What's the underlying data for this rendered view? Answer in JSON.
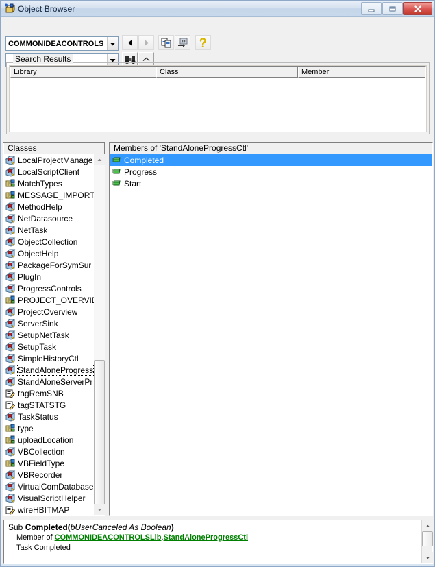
{
  "window": {
    "title": "Object Browser",
    "icon": "object-browser-icon",
    "buttons": {
      "minimize": "minimize-button",
      "restore": "restore-button",
      "close": "close-button"
    }
  },
  "toolbar": {
    "library_combo": {
      "value": "COMMONIDEACONTROLS",
      "placeholder": ""
    },
    "search_combo": {
      "value": "",
      "placeholder": ""
    },
    "buttons": [
      {
        "name": "back-button",
        "icon": "left-arrow-icon",
        "enabled": true
      },
      {
        "name": "forward-button",
        "icon": "right-arrow-icon",
        "enabled": false
      },
      {
        "name": "copy-button",
        "icon": "copy-icon",
        "enabled": true
      },
      {
        "name": "view-definition-button",
        "icon": "view-definition-icon",
        "enabled": true
      },
      {
        "name": "help-button",
        "icon": "question-mark-icon",
        "enabled": true
      },
      {
        "name": "search-button",
        "icon": "binoculars-icon",
        "enabled": true
      },
      {
        "name": "toggle-search-results-button",
        "icon": "chevron-up-icon",
        "enabled": true
      }
    ]
  },
  "search_results": {
    "label": "Search Results",
    "columns": [
      "Library",
      "Class",
      "Member"
    ],
    "rows": []
  },
  "classes_pane": {
    "header": "Classes",
    "items": [
      {
        "label": "LocalProjectManage",
        "icon": "class-icon"
      },
      {
        "label": "LocalScriptClient",
        "icon": "class-icon"
      },
      {
        "label": "MatchTypes",
        "icon": "enum-icon"
      },
      {
        "label": "MESSAGE_IMPORTÄ",
        "icon": "enum-icon"
      },
      {
        "label": "MethodHelp",
        "icon": "class-icon"
      },
      {
        "label": "NetDatasource",
        "icon": "class-icon"
      },
      {
        "label": "NetTask",
        "icon": "class-icon"
      },
      {
        "label": "ObjectCollection",
        "icon": "class-icon"
      },
      {
        "label": "ObjectHelp",
        "icon": "class-icon"
      },
      {
        "label": "PackageForSymSur",
        "icon": "class-icon"
      },
      {
        "label": "PlugIn",
        "icon": "class-icon"
      },
      {
        "label": "ProgressControls",
        "icon": "class-icon"
      },
      {
        "label": "PROJECT_OVERVIE",
        "icon": "enum-icon"
      },
      {
        "label": "ProjectOverview",
        "icon": "class-icon"
      },
      {
        "label": "ServerSink",
        "icon": "class-icon"
      },
      {
        "label": "SetupNetTask",
        "icon": "class-icon"
      },
      {
        "label": "SetupTask",
        "icon": "class-icon"
      },
      {
        "label": "SimpleHistoryCtl",
        "icon": "class-icon"
      },
      {
        "label": "StandAloneProgress",
        "icon": "class-icon",
        "focused": true
      },
      {
        "label": "StandAloneServerPr",
        "icon": "class-icon"
      },
      {
        "label": "tagRemSNB",
        "icon": "type-icon"
      },
      {
        "label": "tagSTATSTG",
        "icon": "type-icon"
      },
      {
        "label": "TaskStatus",
        "icon": "class-icon"
      },
      {
        "label": "type",
        "icon": "enum-icon"
      },
      {
        "label": "uploadLocation",
        "icon": "enum-icon"
      },
      {
        "label": "VBCollection",
        "icon": "class-icon"
      },
      {
        "label": "VBFieldType",
        "icon": "enum-icon"
      },
      {
        "label": "VBRecorder",
        "icon": "class-icon"
      },
      {
        "label": "VirtualComDatabase",
        "icon": "class-icon"
      },
      {
        "label": "VisualScriptHelper",
        "icon": "class-icon"
      },
      {
        "label": "wireHBITMAP",
        "icon": "type-icon"
      }
    ]
  },
  "members_pane": {
    "header": "Members of 'StandAloneProgressCtl'",
    "items": [
      {
        "label": "Completed",
        "icon": "method-icon",
        "selected": true
      },
      {
        "label": "Progress",
        "icon": "method-icon",
        "selected": false
      },
      {
        "label": "Start",
        "icon": "method-icon",
        "selected": false
      }
    ]
  },
  "detail_pane": {
    "signature_prefix": "Sub ",
    "signature_name": "Completed",
    "signature_open": "(",
    "signature_params": "bUserCanceled As Boolean",
    "signature_close": ")",
    "member_of_label": "Member of ",
    "member_of_library": "COMMONIDEACONTROLSLib",
    "member_of_separator": ".",
    "member_of_class": "StandAloneProgressCtl",
    "description": "Task Completed"
  },
  "colors": {
    "selection": "#3399ff",
    "link": "#008000",
    "face": "#f0f0f0",
    "title_bar": "#c9d9ec",
    "close_button": "#d9534f"
  }
}
